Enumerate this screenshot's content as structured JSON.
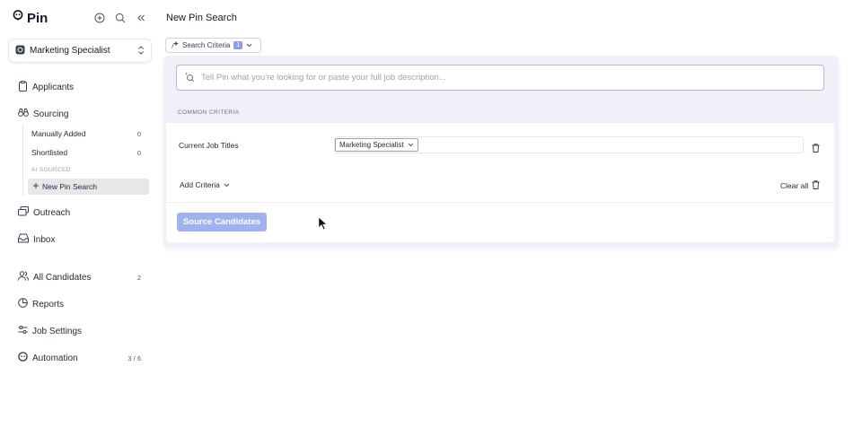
{
  "app": {
    "name": "Pin"
  },
  "job_selector": {
    "value": "Marketing Specialist"
  },
  "nav": {
    "applicants": "Applicants",
    "sourcing": "Sourcing",
    "sourcing_items": [
      {
        "label": "Manually Added",
        "count": "0"
      },
      {
        "label": "Shortlisted",
        "count": "0"
      }
    ],
    "ai_sourced_label": "AI SOURCED",
    "new_pin_search": "New Pin Search",
    "outreach": "Outreach",
    "inbox": "Inbox",
    "all_candidates": {
      "label": "All Candidates",
      "count": "2"
    },
    "reports": "Reports",
    "job_settings": "Job Settings",
    "automation": {
      "label": "Automation",
      "count": "3 / 6"
    }
  },
  "main": {
    "title": "New Pin Search",
    "criteria_button": {
      "label": "Search Criteria",
      "badge": "1"
    },
    "prompt_placeholder": "Tell Pin what you're looking for or paste your full job description...",
    "common_criteria_label": "COMMON CRITERIA",
    "field": {
      "label": "Current Job Titles",
      "chip": "Marketing Specialist"
    },
    "add_criteria": "Add Criteria",
    "clear_all": "Clear all",
    "source_button": "Source Candidates"
  },
  "colors": {
    "accent": "#9fb3f0",
    "badge": "#8b9ee8",
    "input_border": "#b7b4e8",
    "panel_bg": "#f1f0f9"
  }
}
